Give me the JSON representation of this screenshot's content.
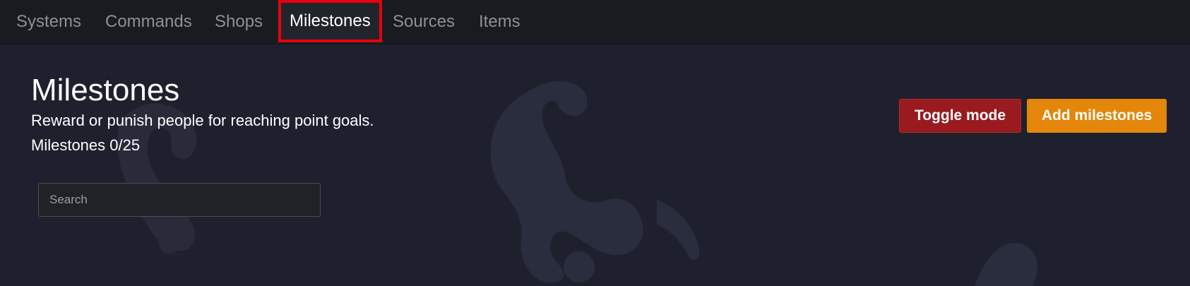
{
  "nav": {
    "tabs": [
      {
        "label": "Systems"
      },
      {
        "label": "Commands"
      },
      {
        "label": "Shops"
      },
      {
        "label": "Milestones",
        "active": true
      },
      {
        "label": "Sources"
      },
      {
        "label": "Items"
      }
    ],
    "highlight_color": "#e8000b"
  },
  "page": {
    "title": "Milestones",
    "subtitle": "Reward or punish people for reaching point goals.",
    "count_text": "Milestones 0/25"
  },
  "search": {
    "placeholder": "Search",
    "value": ""
  },
  "actions": {
    "toggle_label": "Toggle mode",
    "toggle_color": "#991b1f",
    "add_label": "Add milestones",
    "add_color": "#e3860a"
  },
  "background": {
    "art_icon": "faint-dragon-silhouette"
  }
}
